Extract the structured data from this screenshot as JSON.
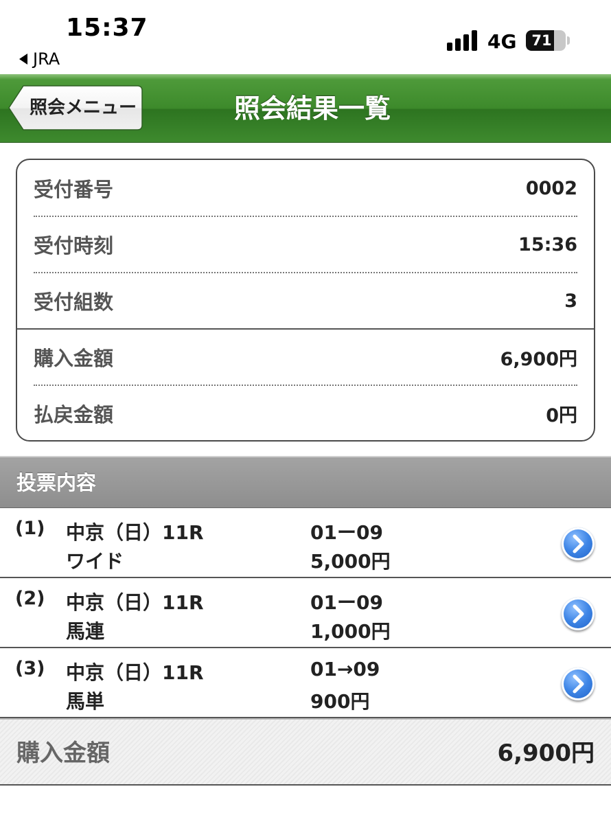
{
  "status_bar": {
    "time": "15:37",
    "back_app": "JRA",
    "network": "4G",
    "battery": "71",
    "battery_fraction": 0.71
  },
  "nav": {
    "back_label": "照会メニュー",
    "title": "照会結果一覧"
  },
  "summary": {
    "rows": [
      {
        "label": "受付番号",
        "value": "0002"
      },
      {
        "label": "受付時刻",
        "value": "15:36"
      },
      {
        "label": "受付組数",
        "value": "3"
      },
      {
        "label": "購入金額",
        "value": "6,900円"
      },
      {
        "label": "払戻金額",
        "value": "0円"
      }
    ]
  },
  "section": {
    "title": "投票内容"
  },
  "bets": [
    {
      "index": "(1)",
      "race": "中京（日）11R",
      "type": "ワイド",
      "combination": "01ー09",
      "amount": "5,000円",
      "icon": "chevron-right-circle-icon"
    },
    {
      "index": "(2)",
      "race": "中京（日）11R",
      "type": "馬連",
      "combination": "01ー09",
      "amount": "1,000円",
      "icon": "chevron-right-circle-icon"
    },
    {
      "index": "(3)",
      "race": "中京（日）11R",
      "type": "馬単",
      "combination": "01→09",
      "amount": "900円",
      "icon": "chevron-right-circle-icon"
    }
  ],
  "total": {
    "label": "購入金額",
    "value": "6,900円"
  },
  "colors": {
    "nav_green": "#3d8a2b",
    "section_gray": "#999999",
    "detail_blue": "#3f86e6"
  }
}
